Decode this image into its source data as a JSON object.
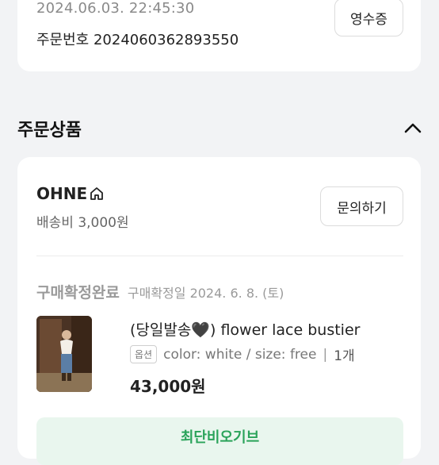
{
  "order": {
    "datetime": "2024.06.03. 22:45:30",
    "order_number": "주문번호 2024060362893550",
    "receipt_label": "영수증"
  },
  "section": {
    "title": "주문상품",
    "collapse_icon": "chevron-up-icon"
  },
  "shop": {
    "name": "OHNE",
    "home_icon": "home-icon",
    "shipping": "배송비 3,000원",
    "inquiry_label": "문의하기"
  },
  "status": {
    "label": "구매확정완료",
    "date": "구매확정일 2024. 6. 8. (토)"
  },
  "product": {
    "title": "(당일발송🖤) flower lace bustier",
    "option_tag": "옵션",
    "option_text": "color: white / size: free",
    "quantity": "1개",
    "price": "43,000원"
  },
  "action": {
    "label": "최단비오기브"
  }
}
